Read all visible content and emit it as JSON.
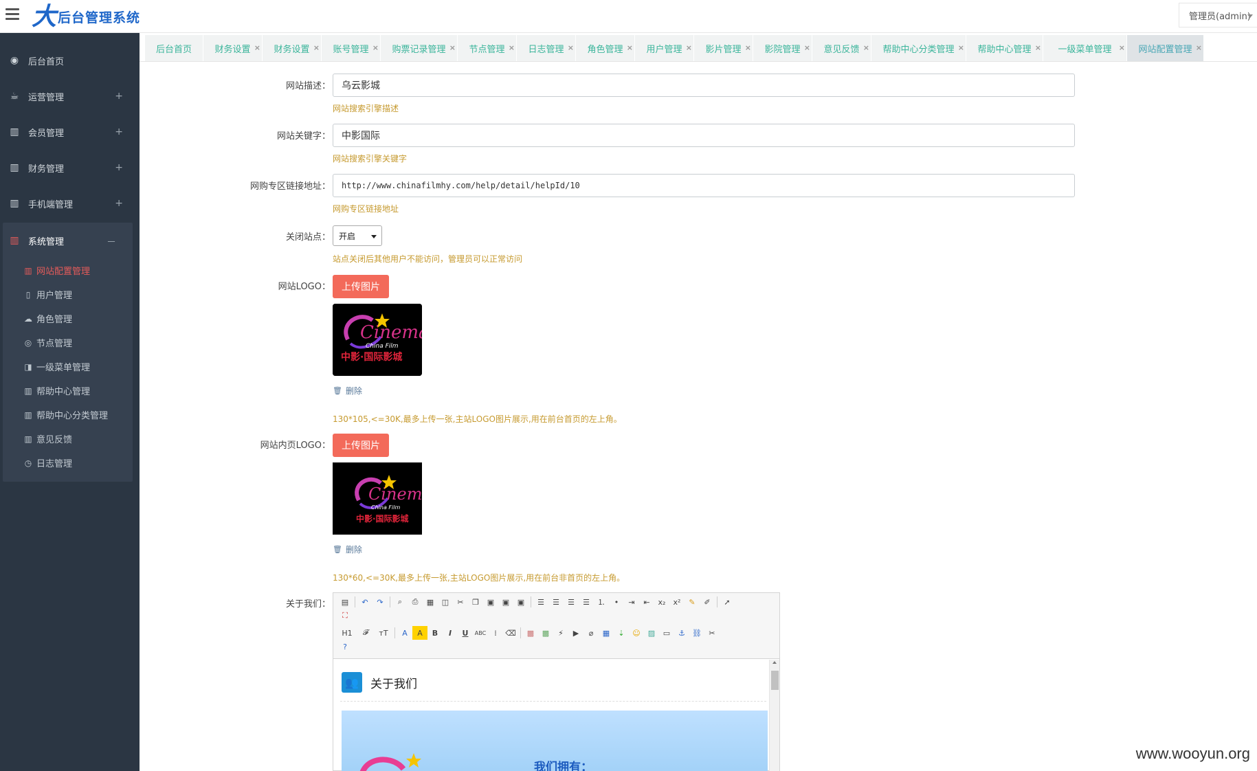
{
  "header": {
    "logo_mark": "大",
    "app_title": "后台管理系统",
    "user_label": "管理员(admin)"
  },
  "sidebar": {
    "items": [
      {
        "label": "后台首页",
        "icon": "dashboard-icon"
      },
      {
        "label": "运营管理",
        "icon": "coffee-icon"
      },
      {
        "label": "会员管理",
        "icon": "bar-chart-icon"
      },
      {
        "label": "财务管理",
        "icon": "bar-chart-icon"
      },
      {
        "label": "手机端管理",
        "icon": "bar-chart-icon"
      }
    ],
    "expanded": {
      "label": "系统管理",
      "collapse_sign": "－",
      "sub_items": [
        {
          "label": "网站配置管理",
          "icon": "bar-chart-icon",
          "active": true
        },
        {
          "label": "用户管理",
          "icon": "document-icon"
        },
        {
          "label": "角色管理",
          "icon": "cloud-upload-icon"
        },
        {
          "label": "节点管理",
          "icon": "record-icon"
        },
        {
          "label": "一级菜单管理",
          "icon": "book-icon"
        },
        {
          "label": "帮助中心管理",
          "icon": "bar-chart-icon"
        },
        {
          "label": "帮助中心分类管理",
          "icon": "bar-chart-icon"
        },
        {
          "label": "意见反馈",
          "icon": "bar-chart-icon"
        },
        {
          "label": "日志管理",
          "icon": "clock-icon"
        }
      ]
    },
    "expand_sign": "+"
  },
  "tabs": [
    {
      "label": "后台首页",
      "closable": false
    },
    {
      "label": "财务设置",
      "closable": true
    },
    {
      "label": "财务设置",
      "closable": true
    },
    {
      "label": "账号管理",
      "closable": true
    },
    {
      "label": "购票记录管理",
      "closable": true
    },
    {
      "label": "节点管理",
      "closable": true
    },
    {
      "label": "日志管理",
      "closable": true
    },
    {
      "label": "角色管理",
      "closable": true
    },
    {
      "label": "用户管理",
      "closable": true
    },
    {
      "label": "影片管理",
      "closable": true
    },
    {
      "label": "影院管理",
      "closable": true
    },
    {
      "label": "意见反馈",
      "closable": true
    },
    {
      "label": "帮助中心分类管理",
      "closable": true
    },
    {
      "label": "帮助中心管理",
      "closable": true
    },
    {
      "label": "一级菜单管理",
      "closable": true
    },
    {
      "label": "网站配置管理",
      "closable": true,
      "active": true
    }
  ],
  "tab_close_glyph": "×",
  "form": {
    "site_desc": {
      "label": "网站描述：",
      "value": "乌云影城",
      "help": "网站搜索引擎描述"
    },
    "site_keywords": {
      "label": "网站关键字：",
      "value": "中影国际",
      "help": "网站搜索引擎关键字"
    },
    "purchase_link": {
      "label": "网购专区链接地址：",
      "value": "http://www.chinafilmhy.com/help/detail/helpId/10",
      "help": "网购专区链接地址"
    },
    "close_site": {
      "label": "关闭站点：",
      "selected": "开启",
      "help": "站点关闭后其他用户不能访问，管理员可以正常访问"
    },
    "site_logo": {
      "label": "网站LOGO：",
      "upload_label": "上传图片",
      "delete_label": "删除",
      "help": "130*105,<=30K,最多上传一张,主站LOGO图片展示,用在前台首页的左上角。"
    },
    "inner_logo": {
      "label": "网站内页LOGO：",
      "upload_label": "上传图片",
      "delete_label": "删除",
      "help": "130*60,<=30K,最多上传一张,主站LOGO图片展示,用在前台非首页的左上角。"
    },
    "about": {
      "label": "关于我们：",
      "heading": "关于我们",
      "banner_text": "我们拥有："
    }
  },
  "logo_image": {
    "word": "Cinema",
    "sub": "China Film",
    "cn": "中影·国际影城",
    "colors": {
      "word": "#d8328a",
      "cn": "#e0243a",
      "star": "#f5c400"
    }
  },
  "editor_toolbar": {
    "row1": [
      "source-icon",
      "undo-icon",
      "redo-icon",
      "preview-icon",
      "print-icon",
      "template-icon",
      "code-icon",
      "cut-icon",
      "copy-icon",
      "paste-icon",
      "paste-text-icon",
      "paste-word-icon",
      "align-left-icon",
      "align-center-icon",
      "align-right-icon",
      "align-justify-icon",
      "ordered-list-icon",
      "unordered-list-icon",
      "indent-icon",
      "outdent-icon",
      "subscript-icon",
      "superscript-icon",
      "clear-format-icon",
      "select-all-icon",
      "cursor-icon"
    ],
    "row2": [
      "fullscreen-icon"
    ],
    "row3": [
      "heading-icon",
      "font-family-icon",
      "font-size-icon",
      "font-color-icon",
      "highlight-icon",
      "bold-icon",
      "italic-icon",
      "underline-icon",
      "strikethrough-icon",
      "line-height-icon",
      "remove-format-icon",
      "image-icon",
      "multi-image-icon",
      "flash-icon",
      "media-icon",
      "attachment-icon",
      "table-icon",
      "horizontal-rule-icon",
      "emoticon-icon",
      "map-icon",
      "pagebreak-icon",
      "anchor-icon",
      "link-icon",
      "unlink-icon"
    ],
    "row4": [
      "help-icon"
    ],
    "text": {
      "heading": "H1",
      "font": "𝓕",
      "size": "тT",
      "color": "A",
      "bold": "B",
      "italic": "I",
      "underline": "U",
      "strike": "ABC"
    }
  },
  "watermark": "www.wooyun.org"
}
